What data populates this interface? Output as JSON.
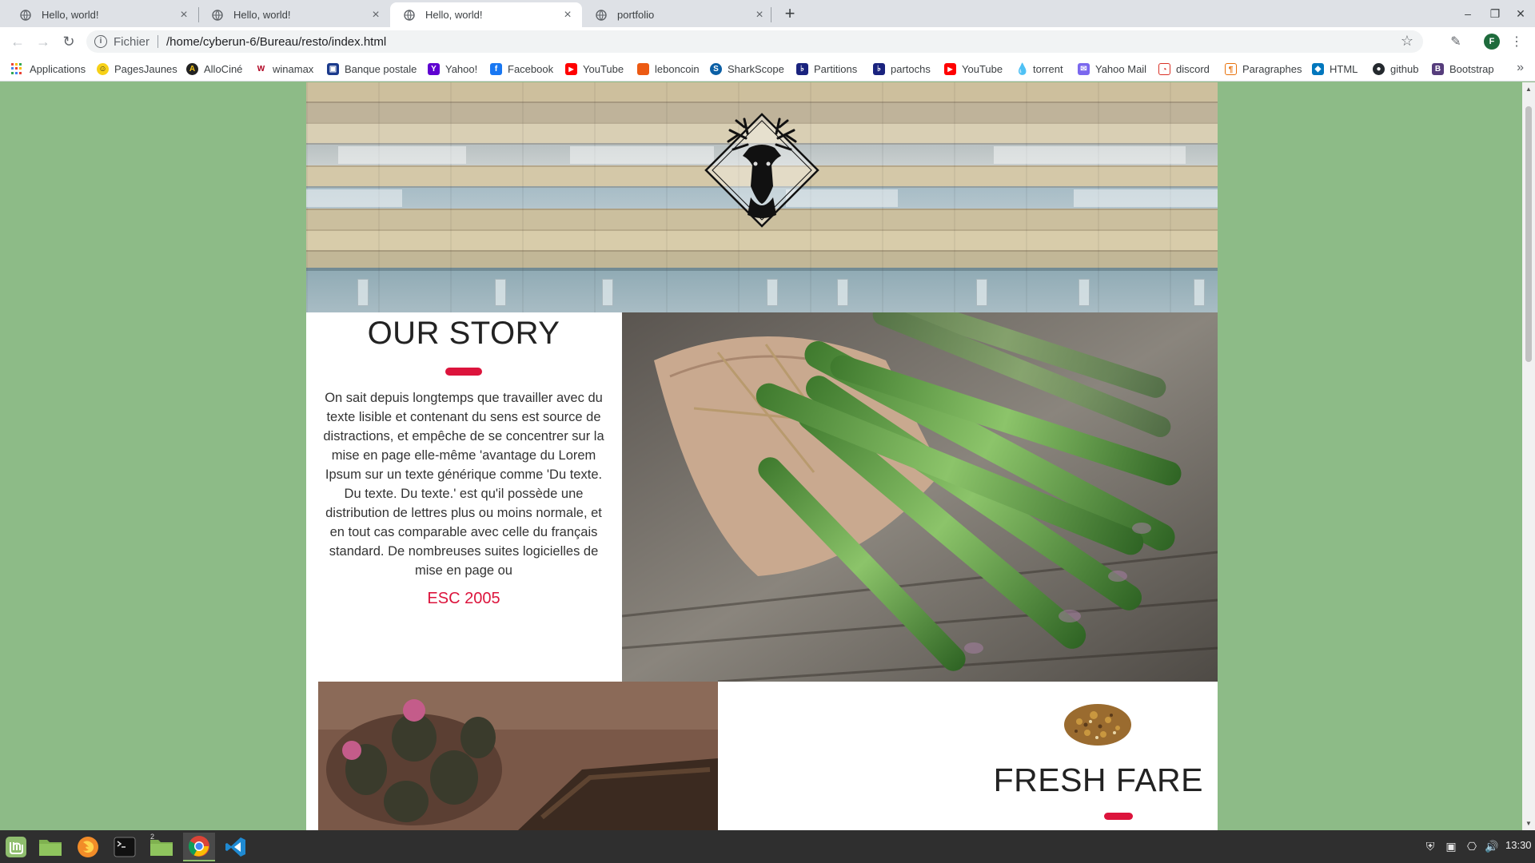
{
  "browser": {
    "tabs": [
      {
        "title": "Hello, world!",
        "active": false
      },
      {
        "title": "Hello, world!",
        "active": false
      },
      {
        "title": "Hello, world!",
        "active": true
      },
      {
        "title": "portfolio",
        "active": false
      }
    ],
    "address": {
      "scheme_label": "Fichier",
      "url": "/home/cyberun-6/Bureau/resto/index.html"
    },
    "profile_initial": "F",
    "bookmarks": [
      {
        "label": "Applications",
        "icon": "apps-grid-icon",
        "color": "#ea4335"
      },
      {
        "label": "PagesJaunes",
        "icon": "pagesjaunes-icon",
        "color": "#f7d117"
      },
      {
        "label": "AlloCiné",
        "icon": "allocine-icon",
        "color": "#f5c518"
      },
      {
        "label": "winamax",
        "icon": "winamax-icon",
        "color": "#b00020"
      },
      {
        "label": "Banque postale",
        "icon": "banque-postale-icon",
        "color": "#1b3a8c"
      },
      {
        "label": "Yahoo!",
        "icon": "yahoo-icon",
        "color": "#5f01d1"
      },
      {
        "label": "Facebook",
        "icon": "facebook-icon",
        "color": "#1877f2"
      },
      {
        "label": "YouTube",
        "icon": "youtube-icon",
        "color": "#ff0000"
      },
      {
        "label": "leboncoin",
        "icon": "leboncoin-icon",
        "color": "#ec5a13"
      },
      {
        "label": "SharkScope",
        "icon": "sharkscope-icon",
        "color": "#0b5fa5"
      },
      {
        "label": "Partitions",
        "icon": "partitions-icon",
        "color": "#1a237e"
      },
      {
        "label": "partochs",
        "icon": "partochs-icon",
        "color": "#1a237e"
      },
      {
        "label": "YouTube",
        "icon": "youtube-icon",
        "color": "#ff0000"
      },
      {
        "label": "torrent",
        "icon": "torrent-icon",
        "color": "#2196f3"
      },
      {
        "label": "Yahoo Mail",
        "icon": "yahoo-mail-icon",
        "color": "#7b68ee"
      },
      {
        "label": "discord",
        "icon": "discord-icon",
        "color": "#d93025"
      },
      {
        "label": "Paragraphes",
        "icon": "paragraphes-icon",
        "color": "#e8710a"
      },
      {
        "label": "HTML",
        "icon": "html-icon",
        "color": "#0277bd"
      },
      {
        "label": "github",
        "icon": "github-icon",
        "color": "#24292e"
      },
      {
        "label": "Bootstrap",
        "icon": "bootstrap-icon",
        "color": "#563d7c"
      }
    ]
  },
  "page": {
    "background": "#8dbb87",
    "accent": "#dc143c",
    "story": {
      "title": "OUR STORY",
      "body": "On sait depuis longtemps que travailler avec du texte lisible et contenant du sens est source de distractions, et empêche de se concentrer sur la mise en page elle-même 'avantage du Lorem Ipsum sur un texte générique comme 'Du texte. Du texte. Du texte.' est qu'il possède une distribution de lettres plus ou moins normale, et en tout cas comparable avec celle du français standard. De nombreuses suites logicielles de mise en page ou",
      "established": "ESC 2005"
    },
    "fresh": {
      "title": "FRESH FARE"
    }
  },
  "taskbar": {
    "clock": "13:30",
    "workspace_badge": "2",
    "apps": [
      "mint-menu-icon",
      "files-icon",
      "firefox-icon",
      "terminal-icon",
      "files-icon",
      "chrome-icon",
      "vscode-icon"
    ]
  }
}
